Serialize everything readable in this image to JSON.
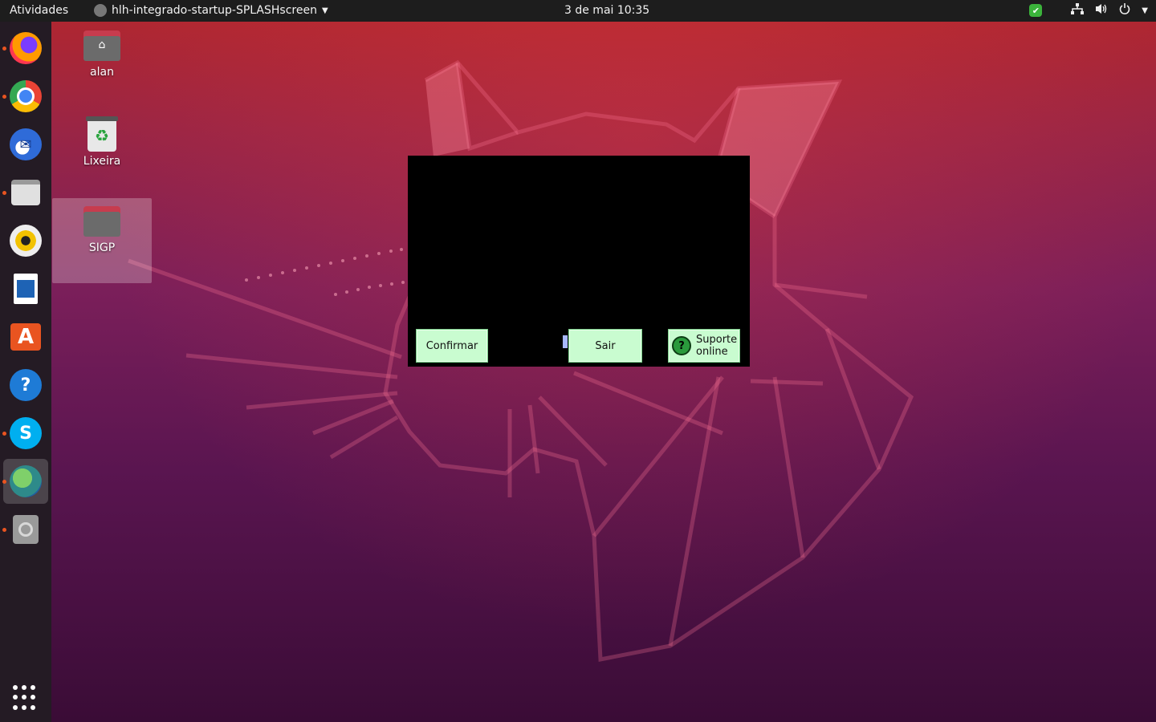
{
  "topbar": {
    "activities": "Atividades",
    "app_name": "hlh-integrado-startup-SPLASHscreen",
    "clock": "3 de mai  10:35"
  },
  "dock": {
    "items": [
      {
        "name": "firefox",
        "running": true,
        "color": "#ff7139"
      },
      {
        "name": "chrome",
        "running": true,
        "color": "#4285f4"
      },
      {
        "name": "thunderbird",
        "running": false,
        "color": "#2f6bd8"
      },
      {
        "name": "files",
        "running": true,
        "color": "#d8d8d8"
      },
      {
        "name": "rhythmbox",
        "running": false,
        "color": "#f2c200"
      },
      {
        "name": "libreoffice-writer",
        "running": false,
        "color": "#1e63b5"
      },
      {
        "name": "ubuntu-software",
        "running": false,
        "color": "#e95420"
      },
      {
        "name": "help",
        "running": false,
        "color": "#1e7bd6"
      },
      {
        "name": "skype",
        "running": true,
        "color": "#00aff0"
      },
      {
        "name": "java-app",
        "running": true,
        "color": "#3a9b5a"
      },
      {
        "name": "disc-drive",
        "running": true,
        "color": "#aaaaaa"
      }
    ]
  },
  "desktop": {
    "icons": [
      {
        "label": "alan",
        "type": "home-folder"
      },
      {
        "label": "Lixeira",
        "type": "trash"
      },
      {
        "label": "SIGP",
        "type": "folder"
      }
    ]
  },
  "dialog": {
    "confirm_label": "Confirmar",
    "exit_label": "Sair",
    "support_line1": "Suporte",
    "support_line2": "online"
  }
}
